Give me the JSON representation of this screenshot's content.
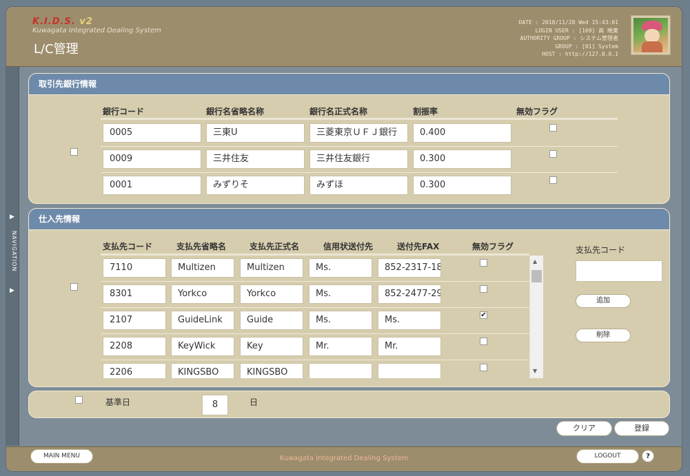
{
  "header": {
    "logo_mark": "K.I.D.S.",
    "logo_version": "v2",
    "logo_subtitle": "Kuwagata Integrated Dealing System",
    "page_title": "L/C管理",
    "date_line": "DATE : 2018/11/28 Wed 15:43:01",
    "login_user_line": "LOGIN USER : [169] 高 暁東",
    "authority_line": "AUTHORITY GROUP : システム管理者",
    "group_line": "GROUP : [01] System",
    "host_line": "HOST : http://127.0.0.1"
  },
  "nav": {
    "label": "NAVIGATION",
    "arrow_top": "▶",
    "arrow_bottom": "▶"
  },
  "bank_panel": {
    "title": "取引先銀行情報",
    "columns": [
      "銀行コード",
      "銀行名省略名称",
      "銀行名正式名称",
      "割振率",
      "無効フラグ"
    ],
    "rows": [
      {
        "code": "0005",
        "short": "三東U",
        "full": "三菱東京ＵＦＪ銀行",
        "rate": "0.400",
        "invalid": false
      },
      {
        "code": "0009",
        "short": "三井住友",
        "full": "三井住友銀行",
        "rate": "0.300",
        "invalid": false
      },
      {
        "code": "0001",
        "short": "みずりそ",
        "full": "みずほ",
        "rate": "0.300",
        "invalid": false
      }
    ],
    "select_all": false
  },
  "supplier_panel": {
    "title": "仕入先情報",
    "columns": [
      "支払先コード",
      "支払先省略名",
      "支払先正式名",
      "信用状送付先",
      "送付先FAX",
      "無効フラグ"
    ],
    "rows": [
      {
        "code": "7110",
        "short": "Multizen",
        "full": "Multizen",
        "lc_to": "Ms.",
        "fax": "852-2317-18",
        "invalid": false
      },
      {
        "code": "8301",
        "short": "Yorkco",
        "full": "Yorkco",
        "lc_to": "Ms.",
        "fax": "852-2477-29",
        "invalid": false
      },
      {
        "code": "2107",
        "short": "GuideLink",
        "full": "Guide",
        "lc_to": "Ms.",
        "fax": "Ms.",
        "invalid": true
      },
      {
        "code": "2208",
        "short": "KeyWick",
        "full": "Key",
        "lc_to": "Mr.",
        "fax": "Mr.",
        "invalid": false
      },
      {
        "code": "2206",
        "short": "KINGSBO",
        "full": "KINGSBO",
        "lc_to": "",
        "fax": "",
        "invalid": false
      }
    ],
    "select_all": false,
    "side_label": "支払先コード",
    "side_input": "",
    "add_label": "追加",
    "delete_label": "削除"
  },
  "base_panel": {
    "label": "基準日",
    "value": "8",
    "unit": "日",
    "checked": false
  },
  "actions": {
    "clear_label": "クリア",
    "register_label": "登録"
  },
  "footer": {
    "main_menu_label": "MAIN MENU",
    "brand": "Kuwagata Integrated Dealing System",
    "logout_label": "LOGOUT",
    "help_label": "?"
  },
  "colors": {
    "header_bg": "#9c8d6c",
    "panel_bg": "#d6cdae",
    "panel_head": "#6e8aaa",
    "page_bg": "#6e7f8b",
    "footer_brand": "#f0b79a"
  }
}
